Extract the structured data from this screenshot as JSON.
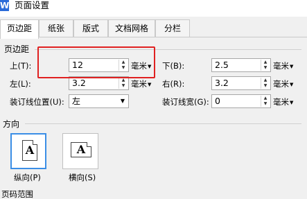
{
  "window": {
    "icon_letter": "W",
    "title": "页面设置"
  },
  "tabs": [
    {
      "label": "页边距",
      "active": true
    },
    {
      "label": "纸张"
    },
    {
      "label": "版式"
    },
    {
      "label": "文档网格"
    },
    {
      "label": "分栏"
    }
  ],
  "margins": {
    "section_title": "页边距",
    "top": {
      "label": "上(T):",
      "value": "12",
      "unit": "毫米"
    },
    "bottom": {
      "label": "下(B):",
      "value": "2.5",
      "unit": "毫米"
    },
    "left": {
      "label": "左(L):",
      "value": "3.2",
      "unit": "毫米"
    },
    "right": {
      "label": "右(R):",
      "value": "3.2",
      "unit": "毫米"
    },
    "gutter_position": {
      "label": "装订线位置(U):",
      "value": "左"
    },
    "gutter_width": {
      "label": "装订线宽(G):",
      "value": "0",
      "unit": "毫米"
    }
  },
  "orientation": {
    "section_title": "方向",
    "portrait": {
      "glyph": "A",
      "label": "纵向(P)",
      "selected": true
    },
    "landscape": {
      "glyph": "A",
      "label": "横向(S)",
      "selected": false
    }
  },
  "next_section_partial": "页码范围",
  "colors": {
    "highlight": "#e02020",
    "selection": "#3a8ee6"
  }
}
